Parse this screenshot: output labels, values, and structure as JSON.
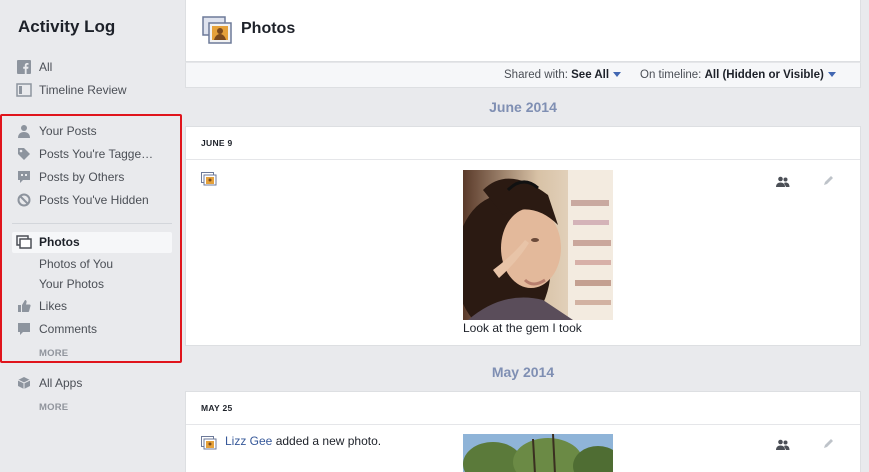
{
  "sidebar": {
    "title": "Activity Log",
    "items": {
      "all": "All",
      "timeline_review": "Timeline Review",
      "your_posts": "Your Posts",
      "posts_tagged": "Posts You're Tagge…",
      "posts_by_others": "Posts by Others",
      "posts_hidden": "Posts You've Hidden",
      "photos": "Photos",
      "photos_of_you": "Photos of You",
      "your_photos": "Your Photos",
      "likes": "Likes",
      "comments": "Comments",
      "more_1": "MORE",
      "all_apps": "All Apps",
      "more_2": "MORE"
    }
  },
  "header": {
    "title": "Photos"
  },
  "filters": {
    "shared_with_label": "Shared with:",
    "shared_with_value": "See All",
    "timeline_label": "On timeline:",
    "timeline_value": "All (Hidden or Visible)"
  },
  "sections": [
    {
      "month": "June 2014",
      "day": "JUNE 9",
      "caption": "Look at the gem I took"
    },
    {
      "month": "May 2014",
      "day": "MAY 25",
      "actor": "Lizz Gee",
      "action": " added a new photo."
    }
  ],
  "colors": {
    "accent": "#4267b2",
    "highlight_border": "#e0141c",
    "month_heading": "#7f8fb3"
  }
}
